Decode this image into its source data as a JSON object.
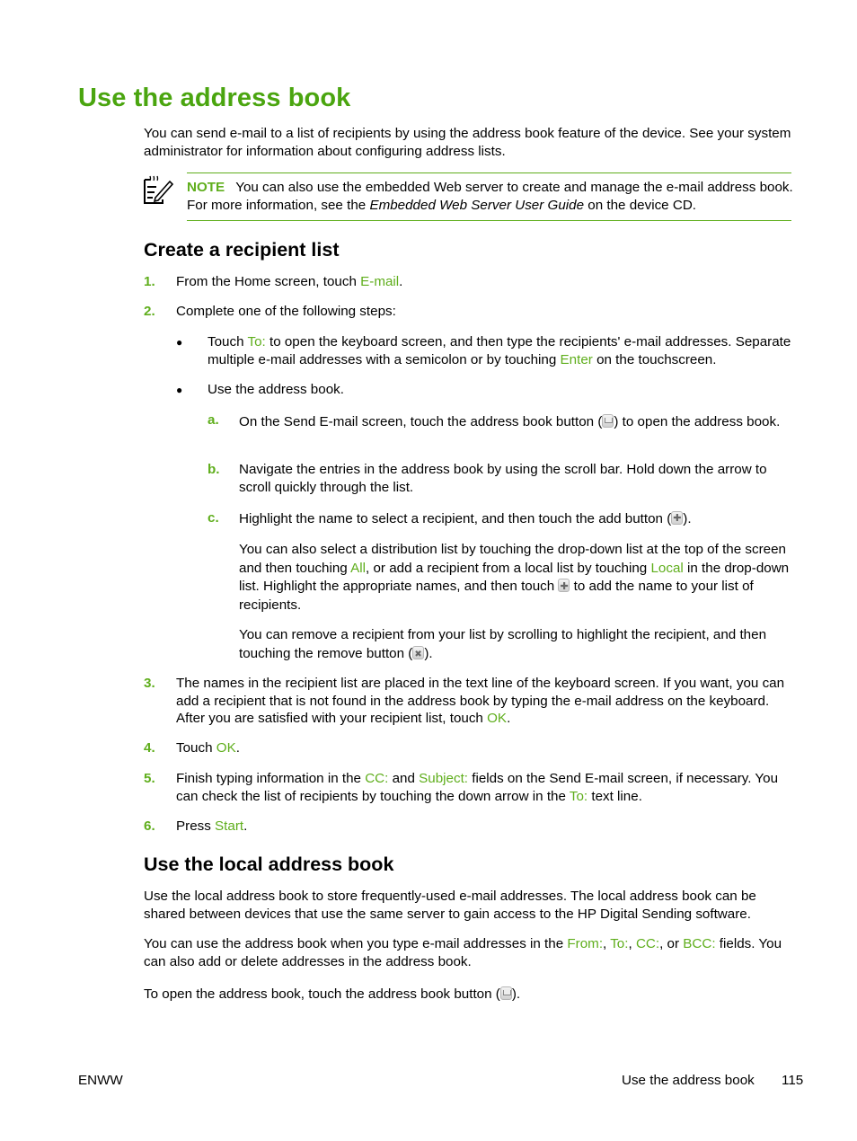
{
  "page": {
    "title": "Use the address book",
    "intro": "You can send e-mail to a list of recipients by using the address book feature of the device. See your system administrator for information about configuring address lists.",
    "note": {
      "icon": "note-pencil-icon",
      "label": "NOTE",
      "text_before": "You can also use the embedded Web server to create and manage the e-mail address book. For more information, see the ",
      "italic": "Embedded Web Server User Guide",
      "text_after": " on the device CD."
    },
    "section1": {
      "heading": "Create a recipient list",
      "steps": [
        {
          "num": "1.",
          "pre": "From the Home screen, touch ",
          "link": "E-mail",
          "post": "."
        },
        {
          "num": "2.",
          "text": "Complete one of the following steps:"
        },
        {
          "num": "3.",
          "pre": "The names in the recipient list are placed in the text line of the keyboard screen. If you want, you can add a recipient that is not found in the address book by typing the e-mail address on the keyboard. After you are satisfied with your recipient list, touch ",
          "link": "OK",
          "post": "."
        },
        {
          "num": "4.",
          "pre": "Touch ",
          "link": "OK",
          "post": "."
        },
        {
          "num": "5.",
          "pre": "Finish typing information in the ",
          "link1": "CC:",
          "mid1": " and ",
          "link2": "Subject:",
          "mid2": " fields on the Send E-mail screen, if necessary. You can check the list of recipients by touching the down arrow in the ",
          "link3": "To:",
          "post": " text line."
        },
        {
          "num": "6.",
          "pre": "Press ",
          "link": "Start",
          "post": "."
        }
      ],
      "bullets": [
        {
          "symbol": "●",
          "pre": "Touch ",
          "link1": "To:",
          "mid": " to open the keyboard screen, and then type the recipients' e-mail addresses. Separate multiple e-mail addresses with a semicolon or by touching ",
          "link2": "Enter",
          "post": " on the touchscreen."
        },
        {
          "symbol": "●",
          "text": "Use the address book."
        }
      ],
      "substeps": [
        {
          "letter": "a.",
          "pre": "On the Send E-mail screen, touch the address book button (",
          "icon": "address-book-button-icon",
          "post": ") to open the address book."
        },
        {
          "letter": "b.",
          "text": "Navigate the entries in the address book by using the scroll bar. Hold down the arrow to scroll quickly through the list."
        },
        {
          "letter": "c.",
          "pre": "Highlight the name to select a recipient, and then touch the add button (",
          "icon": "add-button-icon",
          "post": ")."
        }
      ],
      "sub_c_para1": {
        "pre": "You can also select a distribution list by touching the drop-down list at the top of the screen and then touching ",
        "link1": "All",
        "mid": ", or add a recipient from a local list by touching ",
        "link2": "Local",
        "mid2": " in the drop-down list. Highlight the appropriate names, and then touch ",
        "post": " to add the name to your list of recipients."
      },
      "sub_c_para2": {
        "pre": "You can remove a recipient from your list by scrolling to highlight the recipient, and then touching the remove button (",
        "post": ")."
      }
    },
    "section2": {
      "heading": "Use the local address book",
      "para1": "Use the local address book to store frequently-used e-mail addresses. The local address book can be shared between devices that use the same server to gain access to the HP Digital Sending software.",
      "para2": {
        "pre": "You can use the address book when you type e-mail addresses in the ",
        "f1": "From:",
        "s1": ", ",
        "f2": "To:",
        "s2": ", ",
        "f3": "CC:",
        "s3": ", or ",
        "f4": "BCC:",
        "post": " fields. You can also add or delete addresses in the address book."
      },
      "para3": {
        "pre": "To open the address book, touch the address book button (",
        "post": ")."
      }
    },
    "footer": {
      "left": "ENWW",
      "section": "Use the address book",
      "page_number": "115"
    },
    "colors": {
      "accent": "#5fae1c",
      "title": "#4aa50f"
    }
  }
}
